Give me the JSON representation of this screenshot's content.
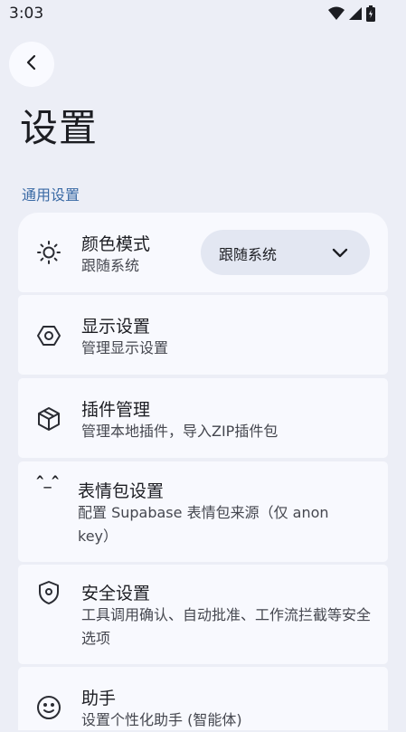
{
  "status_bar": {
    "time": "3:03"
  },
  "header": {
    "title": "设置"
  },
  "sections": [
    {
      "title": "通用设置",
      "items": [
        {
          "icon": "sun-icon",
          "title": "颜色模式",
          "subtitle": "跟随系统",
          "dropdown_value": "跟随系统"
        },
        {
          "icon": "hexagon-nut-icon",
          "title": "显示设置",
          "subtitle": "管理显示设置"
        },
        {
          "icon": "package-box-icon",
          "title": "插件管理",
          "subtitle": "管理本地插件，导入ZIP插件包"
        },
        {
          "icon_text": "^_^",
          "title": "表情包设置",
          "subtitle": "配置 Supabase 表情包来源（仅 anon key）"
        },
        {
          "icon": "shield-icon",
          "title": "安全设置",
          "subtitle": "工具调用确认、自动批准、工作流拦截等安全选项"
        },
        {
          "icon": "smiley-face-icon",
          "title": "助手",
          "subtitle": "设置个性化助手 (智能体)"
        }
      ]
    }
  ]
}
